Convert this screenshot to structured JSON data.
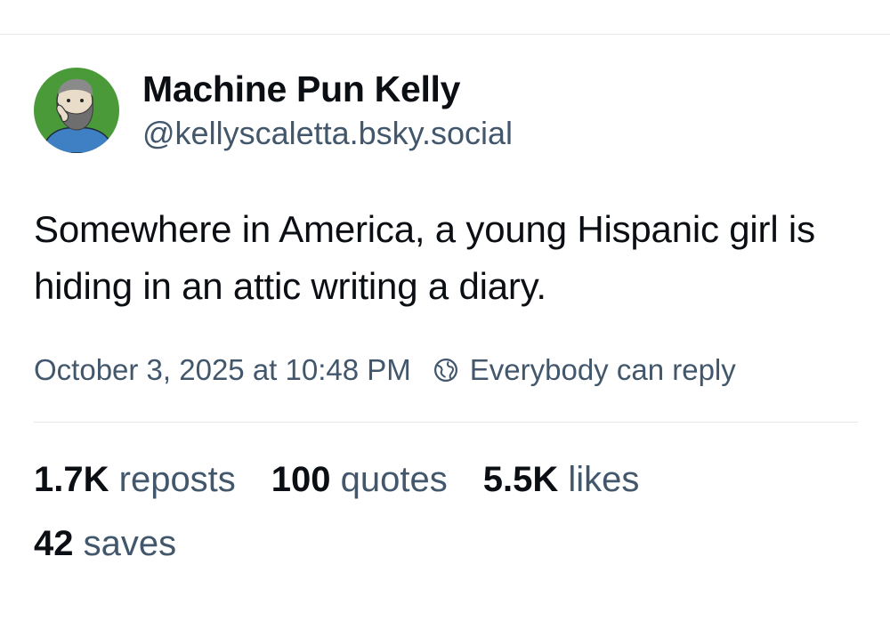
{
  "author": {
    "display_name": "Machine Pun Kelly",
    "handle": "@kellyscaletta.bsky.social",
    "avatar_icon": "bearded-man-portrait-icon"
  },
  "post": {
    "text": "Somewhere in America, a young Hispanic girl is hiding in an attic writing a diary.",
    "timestamp": "October 3, 2025 at 10:48 PM",
    "reply_setting": "Everybody can reply",
    "reply_icon": "globe-reply-icon"
  },
  "stats": {
    "reposts": {
      "count": "1.7K",
      "label": "reposts"
    },
    "quotes": {
      "count": "100",
      "label": "quotes"
    },
    "likes": {
      "count": "5.5K",
      "label": "likes"
    },
    "saves": {
      "count": "42",
      "label": "saves"
    }
  },
  "colors": {
    "text": "#0b0f14",
    "muted": "#42576c",
    "divider": "#e4e7eb",
    "avatar_bg": "#4a9a3a"
  }
}
